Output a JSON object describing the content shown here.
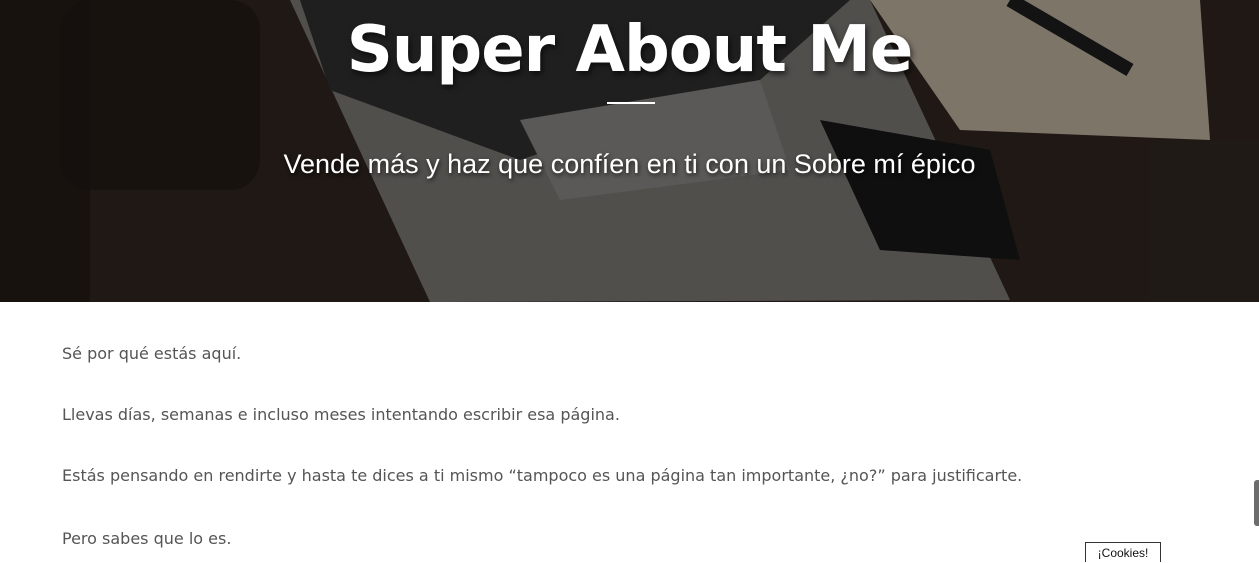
{
  "hero": {
    "title": "Super About Me",
    "subtitle": "Vende más y haz que confíen en ti con un Sobre mí épico"
  },
  "content": {
    "paragraphs": [
      "Sé por qué estás aquí.",
      "Llevas días, semanas e incluso meses intentando escribir esa página.",
      "Estás pensando en rendirte y hasta te dices a ti mismo “tampoco es una página tan importante, ¿no?” para justificarte.",
      "Pero sabes que lo es."
    ]
  },
  "cookies_button": {
    "label": "¡Cookies!"
  },
  "colors": {
    "text": "#555555",
    "hero_text": "#ffffff",
    "background": "#ffffff"
  }
}
